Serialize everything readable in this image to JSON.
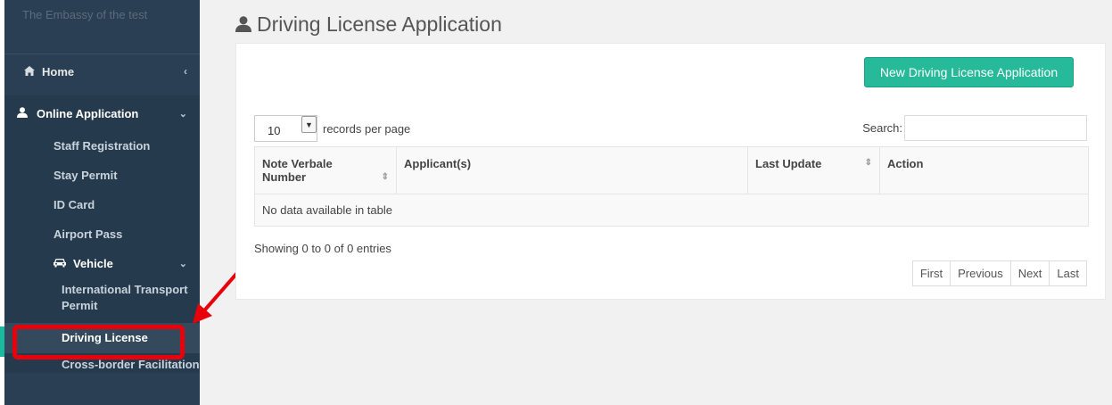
{
  "sidebar": {
    "brand": "The Embassy of the test",
    "home_label": "Home",
    "online_application_label": "Online Application",
    "items": [
      {
        "label": "Staff Registration"
      },
      {
        "label": "Stay Permit"
      },
      {
        "label": "ID Card"
      },
      {
        "label": "Airport Pass"
      }
    ],
    "vehicle_label": "Vehicle",
    "vehicle_items": [
      {
        "label": "International Transport Permit"
      },
      {
        "label": "Driving License"
      },
      {
        "label": "Cross-border Facilitation"
      }
    ],
    "active_item": "Driving License"
  },
  "page": {
    "title": "Driving License Application"
  },
  "toolbar": {
    "new_button_label": "New Driving License Application"
  },
  "table_controls": {
    "page_length_value": "10",
    "records_per_page_label": "records per page",
    "search_label": "Search:",
    "search_value": ""
  },
  "table": {
    "columns": [
      {
        "label": "Note Verbale Number"
      },
      {
        "label": "Applicant(s)"
      },
      {
        "label": "Last Update"
      },
      {
        "label": "Action"
      }
    ],
    "empty_message": "No data available in table"
  },
  "footer": {
    "info": "Showing 0 to 0 of 0 entries",
    "pagination": [
      "First",
      "Previous",
      "Next",
      "Last"
    ]
  },
  "colors": {
    "sidebar_bg": "#2a3f54",
    "accent": "#26b99a",
    "callout": "#e8000b"
  },
  "icons": {
    "home": "home-icon",
    "user": "user-icon",
    "car": "car-icon",
    "chevron": "chevron-icon"
  }
}
